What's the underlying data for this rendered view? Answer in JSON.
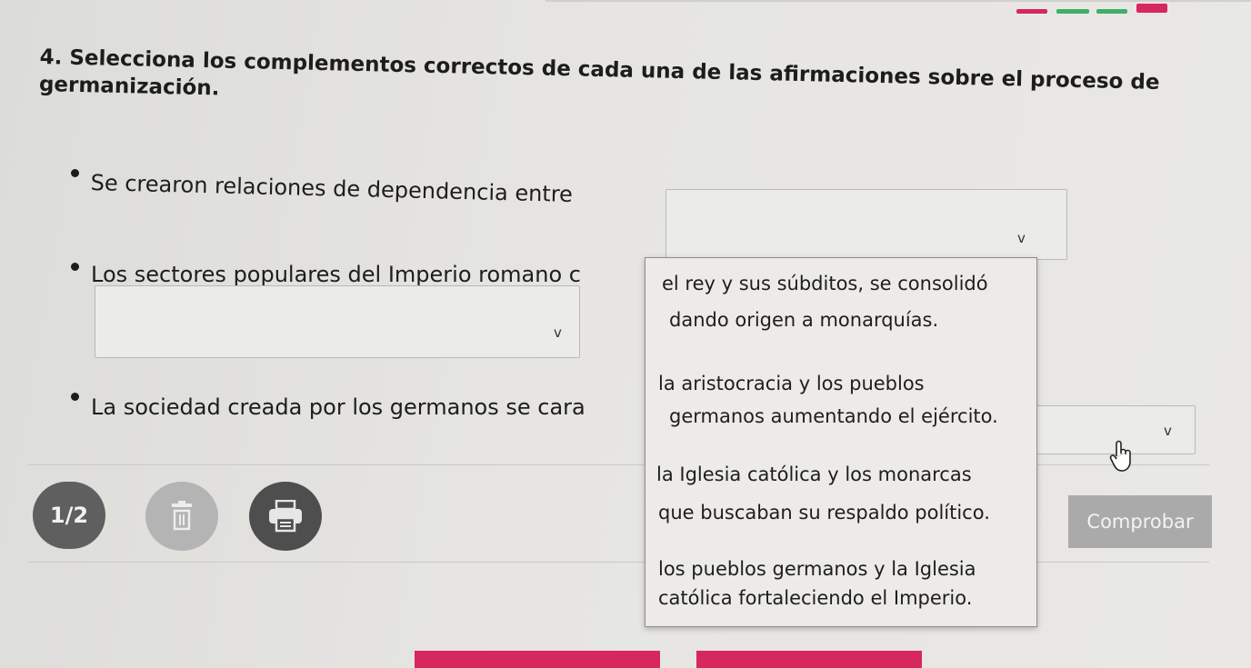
{
  "question": {
    "title_line1": "4. Selecciona los complementos correctos de cada una de las afirmaciones sobre el proceso de",
    "title_line2": "germanización."
  },
  "statements": [
    {
      "text": "Se crearon relaciones de dependencia entre",
      "selected": ""
    },
    {
      "text": "Los sectores populares del Imperio romano c",
      "selected": ""
    },
    {
      "text": "La sociedad creada por los germanos se cara",
      "selected": ""
    }
  ],
  "dropdown": {
    "options": [
      {
        "line1": "el rey y sus súbditos, se consolidó",
        "line2": "dando origen a monarquías."
      },
      {
        "line1": "la aristocracia y los pueblos",
        "line2": "germanos aumentando el ejército."
      },
      {
        "line1": "la Iglesia católica y los monarcas",
        "line2": "que buscaban su respaldo político."
      },
      {
        "line1": "los pueblos germanos y la Iglesia",
        "line2": "católica fortaleciendo el Imperio."
      }
    ]
  },
  "footer": {
    "page_counter": "1/2",
    "check_label": "Comprobar"
  },
  "icons": {
    "delete": "trash-icon",
    "print": "printer-icon",
    "chevron": "chevron-down-icon",
    "cursor": "hand-pointer-icon"
  },
  "chevron_glyph": "v",
  "colors": {
    "page_counter_bg": "#5f5f5f",
    "trash_bg": "#b4b4b4",
    "printer_bg": "#4e4e4e",
    "check_bg": "#aaaaaa",
    "accent_red": "#d6275f",
    "progress_green": "#3fae6a"
  }
}
